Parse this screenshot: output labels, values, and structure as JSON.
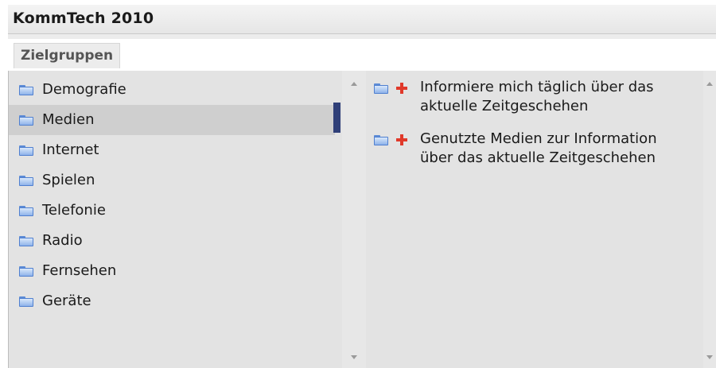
{
  "header": {
    "title": "KommTech 2010"
  },
  "tabs": [
    {
      "label": "Zielgruppen"
    }
  ],
  "categories": {
    "items": [
      {
        "label": "Demografie"
      },
      {
        "label": "Medien"
      },
      {
        "label": "Internet"
      },
      {
        "label": "Spielen"
      },
      {
        "label": "Telefonie"
      },
      {
        "label": "Radio"
      },
      {
        "label": "Fernsehen"
      },
      {
        "label": "Geräte"
      }
    ],
    "selected": "Medien"
  },
  "details": {
    "items": [
      {
        "label": "Informiere mich täglich über das aktuelle Zeitgeschehen"
      },
      {
        "label": "Genutzte Medien zur Information über das aktuelle Zeitgeschehen"
      }
    ]
  },
  "icons": {
    "folder": "folder-icon",
    "add": "plus-icon",
    "scroll_up": "scroll-up-arrow-icon",
    "scroll_down": "scroll-down-arrow-icon"
  },
  "colors": {
    "selection_bar": "#2f3f78",
    "plus": "#e0392a",
    "folder": "#5c8bd6"
  }
}
